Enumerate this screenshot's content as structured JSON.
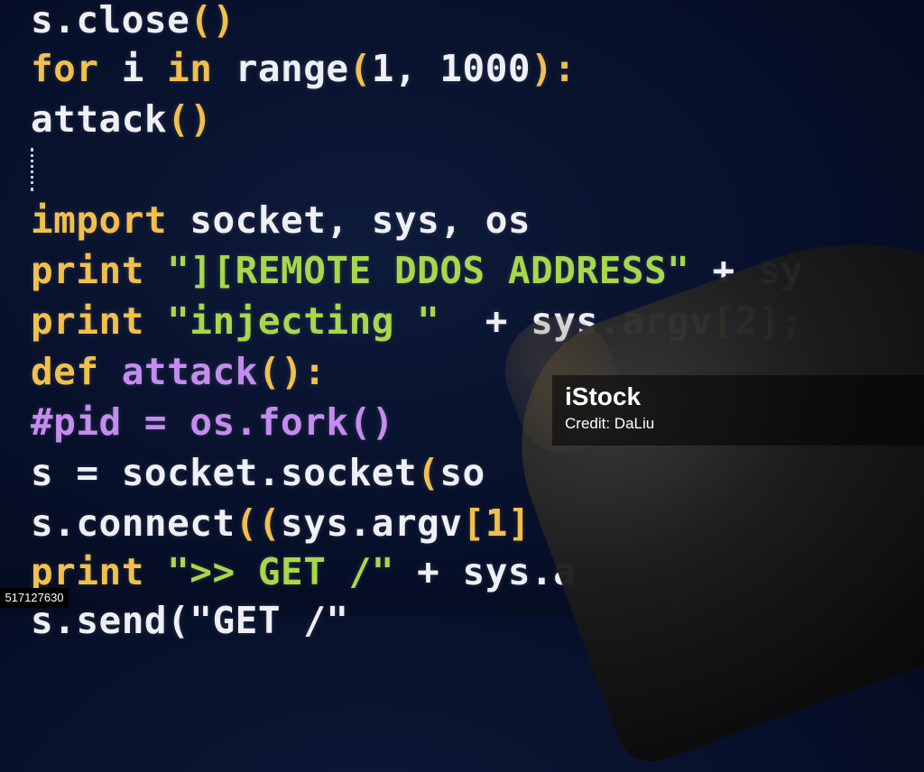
{
  "code_lines": [
    [
      {
        "t": "s.close",
        "c": "pl"
      },
      {
        "t": "()",
        "c": "pn"
      }
    ],
    [
      {
        "t": "for ",
        "c": "kw"
      },
      {
        "t": "i ",
        "c": "pl"
      },
      {
        "t": "in ",
        "c": "kw"
      },
      {
        "t": "range",
        "c": "pl"
      },
      {
        "t": "(",
        "c": "pn"
      },
      {
        "t": "1, 1000",
        "c": "pl"
      },
      {
        "t": "):",
        "c": "pn"
      }
    ],
    [
      {
        "t": "attack",
        "c": "pl"
      },
      {
        "t": "()",
        "c": "pn"
      }
    ],
    [],
    [
      {
        "t": "import ",
        "c": "kw"
      },
      {
        "t": "socket, sys, os",
        "c": "pl"
      }
    ],
    [
      {
        "t": "print ",
        "c": "kw"
      },
      {
        "t": "\"][REMOTE DDOS ADDRESS\"",
        "c": "st"
      },
      {
        "t": " + sy",
        "c": "pl"
      }
    ],
    [
      {
        "t": "print ",
        "c": "kw"
      },
      {
        "t": "\"injecting \"",
        "c": "st"
      },
      {
        "t": "  + sys.argv",
        "c": "pl"
      },
      {
        "t": "[2];",
        "c": "pn"
      }
    ],
    [
      {
        "t": "def ",
        "c": "kw"
      },
      {
        "t": "attack",
        "c": "pu"
      },
      {
        "t": "():",
        "c": "pn"
      }
    ],
    [
      {
        "t": "#pid = os.fork()",
        "c": "pu"
      }
    ],
    [
      {
        "t": "s = socket.socket",
        "c": "pl"
      },
      {
        "t": "(",
        "c": "pn"
      },
      {
        "t": "so",
        "c": "pl"
      }
    ],
    [
      {
        "t": "s.connect",
        "c": "pl"
      },
      {
        "t": "((",
        "c": "pn"
      },
      {
        "t": "sys.argv",
        "c": "pl"
      },
      {
        "t": "[1]",
        "c": "pn"
      }
    ],
    [
      {
        "t": "print ",
        "c": "kw"
      },
      {
        "t": "\">> GET /\"",
        "c": "st"
      },
      {
        "t": " + sys.a",
        "c": "pl"
      }
    ],
    [
      {
        "t": "s.send(\"GET /\"",
        "c": "pl"
      }
    ]
  ],
  "watermark": {
    "logo": "iStock",
    "credit": "Credit: DaLiu"
  },
  "stock_id": "517127630",
  "colors": {
    "keyword": "#f2c04a",
    "plain": "#eef0f6",
    "string": "#a7d84a",
    "purple": "#c58cf0",
    "background": "#07102a"
  }
}
